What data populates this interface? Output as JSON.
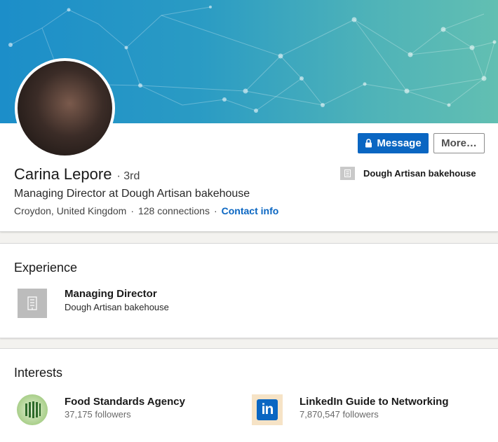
{
  "profile": {
    "name": "Carina Lepore",
    "degree": "· 3rd",
    "headline": "Managing Director at Dough Artisan bakehouse",
    "location": "Croydon, United Kingdom",
    "separator": "·",
    "connections": "128 connections",
    "contact_info": "Contact info",
    "current_company": "Dough Artisan bakehouse"
  },
  "actions": {
    "message_label": "Message",
    "more_label": "More…"
  },
  "experience": {
    "title": "Experience",
    "items": [
      {
        "role": "Managing Director",
        "company": "Dough Artisan bakehouse",
        "icon": "building-icon"
      }
    ]
  },
  "interests": {
    "title": "Interests",
    "items": [
      {
        "name": "Food Standards Agency",
        "followers": "37,175 followers",
        "icon": "fsa-logo"
      },
      {
        "name": "LinkedIn Guide to Networking",
        "followers": "7,870,547 followers",
        "icon": "linkedin-logo",
        "logo_text": "in"
      }
    ]
  },
  "colors": {
    "accent": "#0a66c2",
    "banner_start": "#1c8ec9",
    "banner_end": "#62bfb2"
  }
}
